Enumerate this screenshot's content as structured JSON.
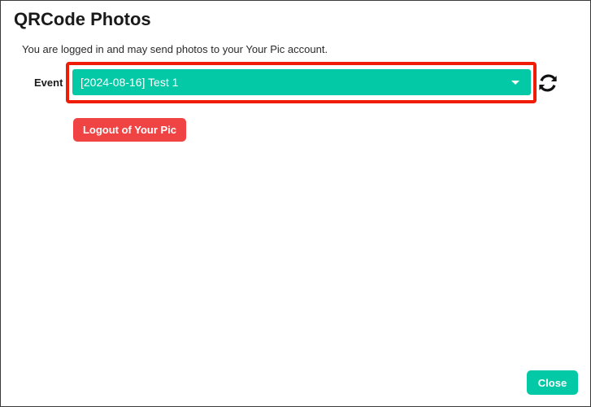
{
  "dialog": {
    "title": "QRCode Photos",
    "status_text": "You are logged in and may send photos to your Your Pic account."
  },
  "event": {
    "label": "Event",
    "selected_value": "[2024-08-16] Test 1",
    "refresh_icon": "refresh-icon"
  },
  "buttons": {
    "logout_label": "Logout of Your Pic",
    "close_label": "Close"
  },
  "colors": {
    "accent": "#04c9a6",
    "danger": "#f04444",
    "highlight": "#ef1c08"
  }
}
